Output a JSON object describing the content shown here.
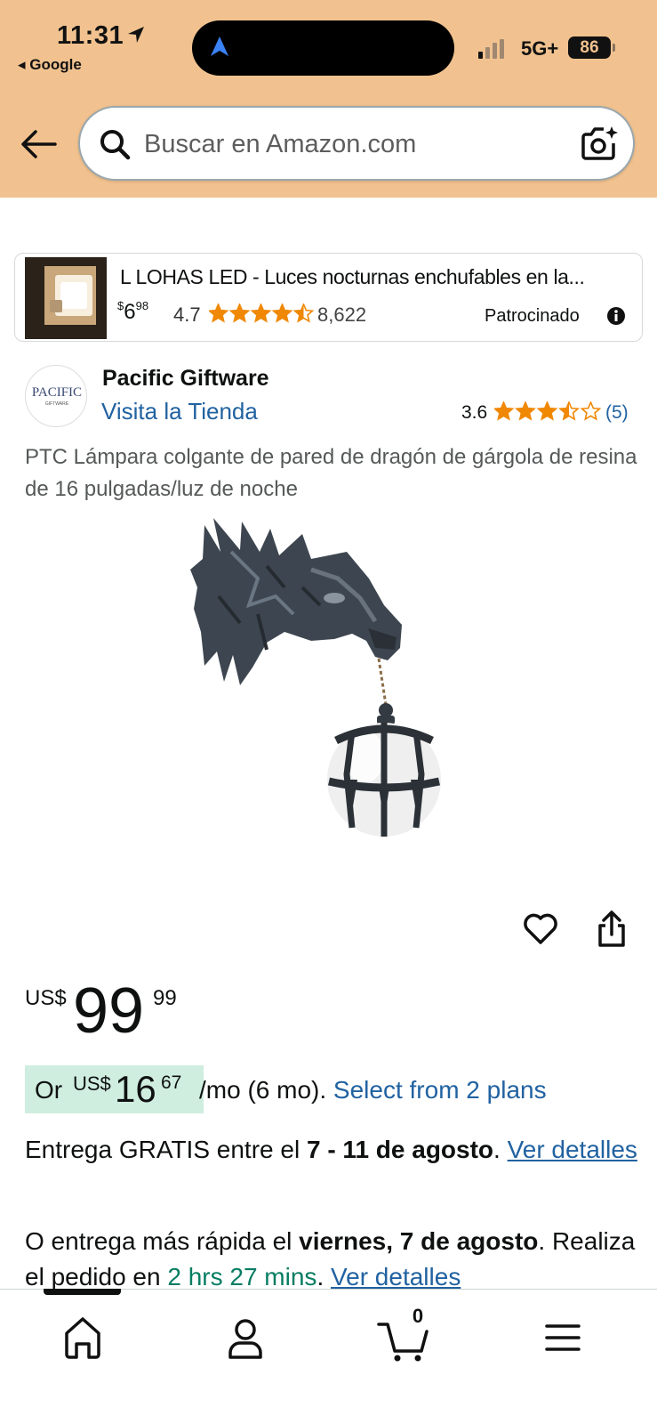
{
  "status_bar": {
    "time": "11:31",
    "back_app": "◂ Google",
    "network": "5G+",
    "battery": "86"
  },
  "search": {
    "placeholder": "Buscar en Amazon.com"
  },
  "sponsored_ad": {
    "title": "L LOHAS LED - Luces nocturnas enchufables en la...",
    "price_whole": "6",
    "price_fraction": "98",
    "price_symbol": "$",
    "rating": "4.7",
    "rating_stars": 4.5,
    "review_count": "8,622",
    "sponsored_label": "Patrocinado"
  },
  "brand": {
    "logo_text": "PACIFIC",
    "logo_subtext": "GIFTWARE",
    "name": "Pacific Giftware",
    "store_link": "Visita la Tienda",
    "rating": "3.6",
    "rating_stars": 3.5,
    "review_count": "(5)"
  },
  "product": {
    "title": "PTC Lámpara colgante de pared de dragón de gárgola de resina de 16 pulgadas/luz de noche",
    "price_currency": "US$",
    "price_whole": "99",
    "price_fraction": "99"
  },
  "installment": {
    "prefix": "Or",
    "currency": "US$",
    "amount_whole": "16",
    "amount_fraction": "67",
    "term": "/mo (6 mo).",
    "link": "Select from 2 plans"
  },
  "delivery": {
    "prefix": "Entrega GRATIS entre el",
    "dates": "7 - 11 de agosto",
    "suffix": ".",
    "link": "Ver detalles"
  },
  "fast_delivery": {
    "prefix": "O entrega más rápida el",
    "date": "viernes, 7 de agosto",
    "middle": ". Realiza el pedido en",
    "countdown": "2 hrs 27 mins",
    "suffix": ".",
    "link": "Ver detalles"
  },
  "tabbar": {
    "cart_count": "0"
  },
  "colors": {
    "header_bg": "#f1c28f",
    "link": "#2162a1",
    "star": "#f08804",
    "installment_badge": "#cfeee0",
    "countdown_green": "#067d62"
  }
}
